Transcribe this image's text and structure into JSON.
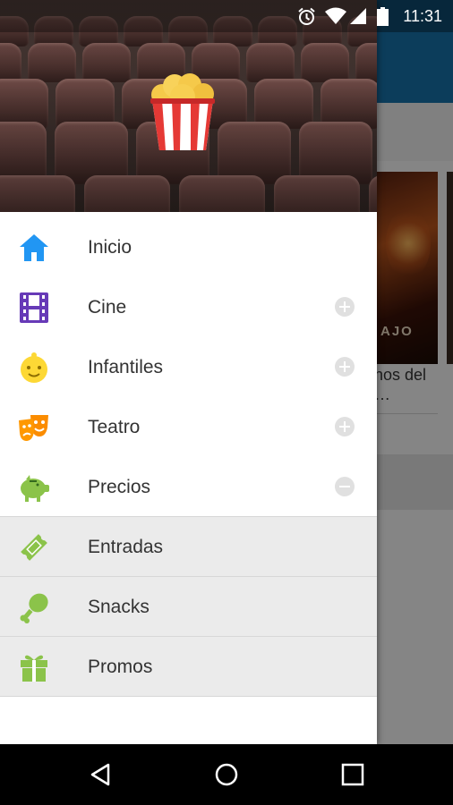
{
  "status_bar": {
    "time": "11:31",
    "icons": [
      "alarm-icon",
      "wifi-icon",
      "signal-icon",
      "battery-icon"
    ]
  },
  "background": {
    "movie_title": "nos del\n…",
    "poster_text": "AJO",
    "toolbar_color": "#1670a6"
  },
  "drawer": {
    "header_image": "cinema-seats",
    "logo": "popcorn-logo-icon",
    "items": [
      {
        "label": "Inicio",
        "icon": "home-icon",
        "color": "#2196f3",
        "expand": null,
        "selected": false
      },
      {
        "label": "Cine",
        "icon": "film-icon",
        "color": "#673ab7",
        "expand": "plus",
        "selected": false
      },
      {
        "label": "Infantiles",
        "icon": "baby-face-icon",
        "color": "#fdd835",
        "expand": "plus",
        "selected": false
      },
      {
        "label": "Teatro",
        "icon": "theater-masks-icon",
        "color": "#ff9800",
        "expand": "plus",
        "selected": false
      },
      {
        "label": "Precios",
        "icon": "piggy-bank-icon",
        "color": "#8bc34a",
        "expand": "minus",
        "selected": false
      },
      {
        "label": "Entradas",
        "icon": "ticket-icon",
        "color": "#8bc34a",
        "expand": null,
        "selected": true
      },
      {
        "label": "Snacks",
        "icon": "drumstick-icon",
        "color": "#8bc34a",
        "expand": null,
        "selected": true
      },
      {
        "label": "Promos",
        "icon": "gift-icon",
        "color": "#8bc34a",
        "expand": null,
        "selected": true
      }
    ]
  },
  "nav_bar": {
    "buttons": [
      "back-icon",
      "home-nav-icon",
      "recents-icon"
    ]
  }
}
